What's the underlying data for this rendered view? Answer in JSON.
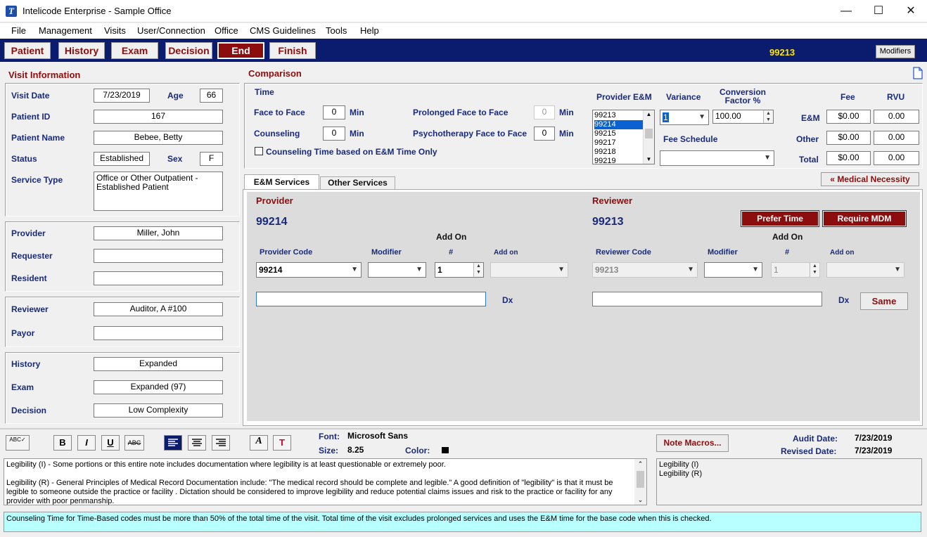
{
  "window": {
    "title": "Intelicode Enterprise - Sample Office",
    "app_icon_letter": "T",
    "minimize": "—",
    "maximize": "☐",
    "close": "✕"
  },
  "menu": [
    "File",
    "Management",
    "Visits",
    "User/Connection",
    "Office",
    "CMS Guidelines",
    "Tools",
    "Help"
  ],
  "nav": {
    "buttons": [
      "Patient",
      "History",
      "Exam",
      "Decision",
      "End",
      "Finish"
    ],
    "active": "End",
    "code": "99213",
    "modifiers_label": "Modifiers"
  },
  "visit_info": {
    "title": "Visit Information",
    "visit_date_label": "Visit Date",
    "visit_date": "7/23/2019",
    "age_label": "Age",
    "age": "66",
    "patient_id_label": "Patient ID",
    "patient_id": "167",
    "patient_name_label": "Patient Name",
    "patient_name": "Bebee, Betty",
    "status_label": "Status",
    "status": "Established",
    "sex_label": "Sex",
    "sex": "F",
    "service_type_label": "Service Type",
    "service_type": "Office or Other Outpatient - Established Patient",
    "provider_label": "Provider",
    "provider": "Miller, John",
    "requester_label": "Requester",
    "requester": "",
    "resident_label": "Resident",
    "resident": "",
    "reviewer_label": "Reviewer",
    "reviewer": "Auditor, A #100",
    "payor_label": "Payor",
    "payor": "",
    "history_label": "History",
    "history": "Expanded",
    "exam_label": "Exam",
    "exam": "Expanded (97)",
    "decision_label": "Decision",
    "decision": "Low Complexity"
  },
  "comparison": {
    "title": "Comparison",
    "time_label": "Time",
    "face_label": "Face to Face",
    "face_value": "0",
    "counseling_label": "Counseling",
    "counseling_value": "0",
    "min_label": "Min",
    "prolonged_label": "Prolonged Face to Face",
    "prolonged_value": "0",
    "psycho_label": "Psychotherapy Face to Face",
    "psycho_value": "0",
    "counseling_check_label": "Counseling Time based on E&M Time Only",
    "provider_em_label": "Provider E&M",
    "provider_em_list": [
      "99213",
      "99214",
      "99215",
      "99217",
      "99218",
      "99219"
    ],
    "provider_em_selected": "99214",
    "variance_label": "Variance",
    "variance_value": "1",
    "conv_factor_label": "Conversion Factor %",
    "conv_factor_value": "100.00",
    "fee_schedule_label": "Fee Schedule",
    "fee_schedule_value": "",
    "fee_label": "Fee",
    "rvu_label": "RVU",
    "em_label": "E&M",
    "other_label": "Other",
    "total_label": "Total",
    "em_fee": "$0.00",
    "em_rvu": "0.00",
    "other_fee": "$0.00",
    "other_rvu": "0.00",
    "total_fee": "$0.00",
    "total_rvu": "0.00"
  },
  "tabs": {
    "items": [
      "E&M Services",
      "Other Services"
    ],
    "active": "E&M Services",
    "medical_necessity_label": "Medical Necessity",
    "medical_necessity_icon": "«"
  },
  "provider_section": {
    "title": "Provider",
    "code_display": "99214",
    "add_on_label": "Add On",
    "code_label": "Provider Code",
    "modifier_label": "Modifier",
    "num_label": "#",
    "addon_col_label": "Add on",
    "code_value": "99214",
    "num_value": "1",
    "dx_label": "Dx",
    "dx_value": ""
  },
  "reviewer_section": {
    "title": "Reviewer",
    "code_display": "99213",
    "add_on_label": "Add On",
    "prefer_time_label": "Prefer Time",
    "require_mdm_label": "Require MDM",
    "code_label": "Reviewer Code",
    "modifier_label": "Modifier",
    "num_label": "#",
    "addon_col_label": "Add on",
    "code_value": "99213",
    "num_value": "1",
    "dx_label": "Dx",
    "dx_value": "",
    "same_label": "Same"
  },
  "toolbar": {
    "font_label": "Font:",
    "font_value": "Microsoft Sans",
    "size_label": "Size:",
    "size_value": "8.25",
    "color_label": "Color:",
    "note_macros_label": "Note Macros...",
    "audit_date_label": "Audit Date:",
    "audit_date": "7/23/2019",
    "revised_date_label": "Revised Date:",
    "revised_date": "7/23/2019",
    "spell_icon": "ABC✓",
    "bold": "B",
    "italic": "I",
    "underline": "U",
    "strike": "ABC",
    "font_icon": "A",
    "textcolor_icon": "T"
  },
  "notes": {
    "p1": "Legibility (I) - Some portions or this entire note includes documentation where legibility is at least questionable or extremely poor.",
    "p2": "Legibility (R) - General Principles of Medical Record Documentation include: \"The medical record should be complete and legible.\"  A good definition of \"legibility\" is that it must be legible to someone outside the practice or facility .  Dictation should be considered to improve legibility and reduce potential claims issues and risk to the practice or facility for any provider with poor penmanship.",
    "list": [
      "Legibility (I)",
      "Legibility (R)"
    ]
  },
  "status_message": "Counseling Time for Time-Based codes must be more than 50% of the total time of the visit. Total time of the visit excludes prolonged services and uses the E&M time for the base code when this is checked.",
  "colors": {
    "nav_bg": "#0b1c6e",
    "accent_red": "#8b0d0d",
    "label_blue": "#1a2a7a",
    "status_bg": "#b8ffff",
    "nav_code": "#ffe600"
  }
}
